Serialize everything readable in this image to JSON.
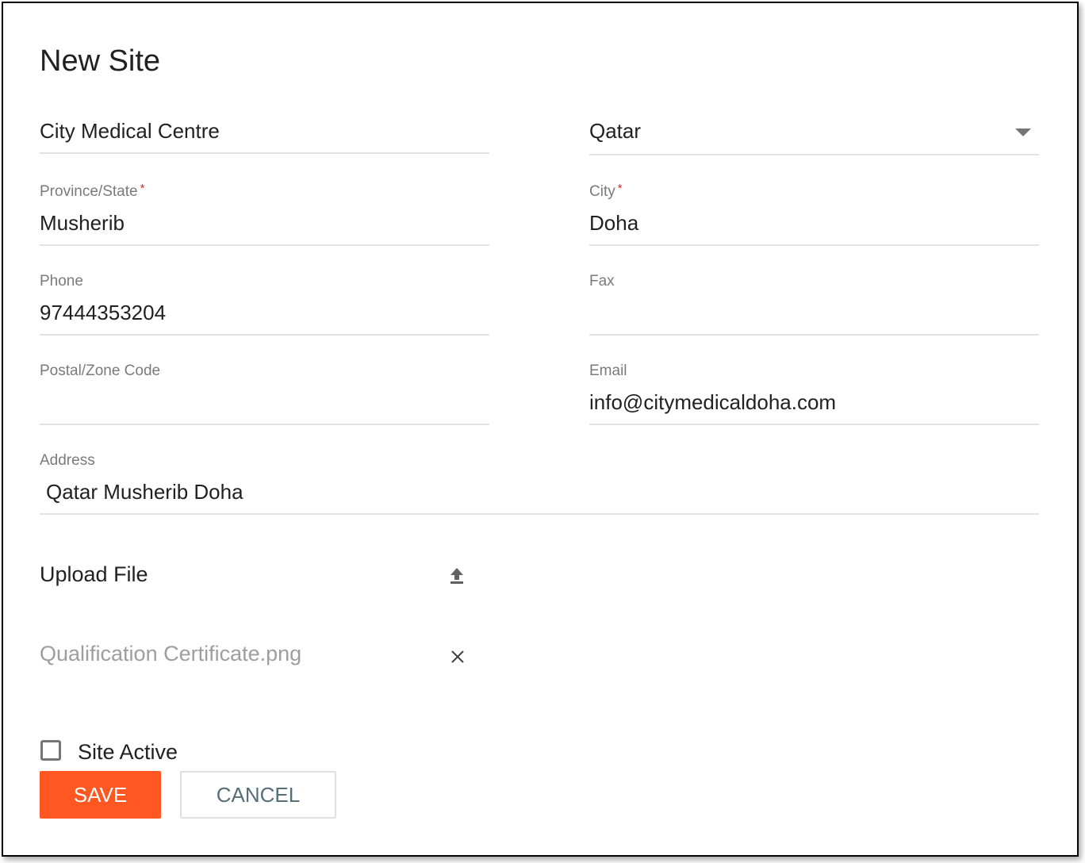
{
  "dialog": {
    "title": "New Site"
  },
  "fields": {
    "site_name": {
      "value": "City Medical Centre"
    },
    "country": {
      "value": "Qatar",
      "icon": "caret-down-icon"
    },
    "province": {
      "label": "Province/State",
      "required_mark": "*",
      "value": "Musherib"
    },
    "city": {
      "label": "City",
      "required_mark": "*",
      "value": "Doha"
    },
    "phone": {
      "label": "Phone",
      "value": "97444353204"
    },
    "fax": {
      "label": "Fax",
      "value": ""
    },
    "postal": {
      "label": "Postal/Zone Code",
      "value": ""
    },
    "email": {
      "label": "Email",
      "value": "info@citymedicaldoha.com"
    },
    "address": {
      "label": "Address",
      "value": "Qatar Musherib Doha"
    }
  },
  "upload": {
    "label": "Upload File",
    "upload_icon": "upload-icon",
    "file_name": "Qualification Certificate.png",
    "remove_icon": "close-icon"
  },
  "site_active": {
    "label": "Site Active",
    "checked": false
  },
  "actions": {
    "save_label": "SAVE",
    "cancel_label": "CANCEL"
  },
  "colors": {
    "accent": "#ff5722",
    "required": "#d32f2f",
    "cancel_text": "#546e7a"
  }
}
